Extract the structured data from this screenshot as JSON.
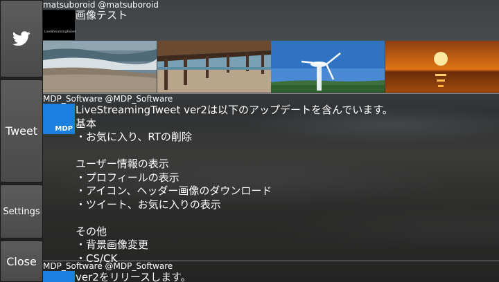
{
  "sidebar": {
    "tweet_label": "Tweet",
    "settings_label": "Settings",
    "close_label": "Close"
  },
  "tweets": [
    {
      "header": "matsuboroid @matsuboroid",
      "avatar_text": "LiveStreamingTweet",
      "text": "画像テスト"
    },
    {
      "header": "MDP_Software @MDP_Software",
      "avatar_text": "MDP",
      "text": "LiveStreamingTweet ver2は以下のアップデートを含んでいます。\n基本\n・お気に入り、RTの削除\n\nユーザー情報の表示\n・プロフィールの表示\n・アイコン、ヘッダー画像のダウンロード\n・ツイート、お気に入りの表示\n\nその他\n・背景画像変更\n・CS/CK"
    },
    {
      "header": "MDP_Software @MDP_Software",
      "text": "ver2をリリースします。"
    }
  ],
  "colors": {
    "mdp_avatar": "#1b7fe0",
    "sidebar_button": "#555555"
  }
}
